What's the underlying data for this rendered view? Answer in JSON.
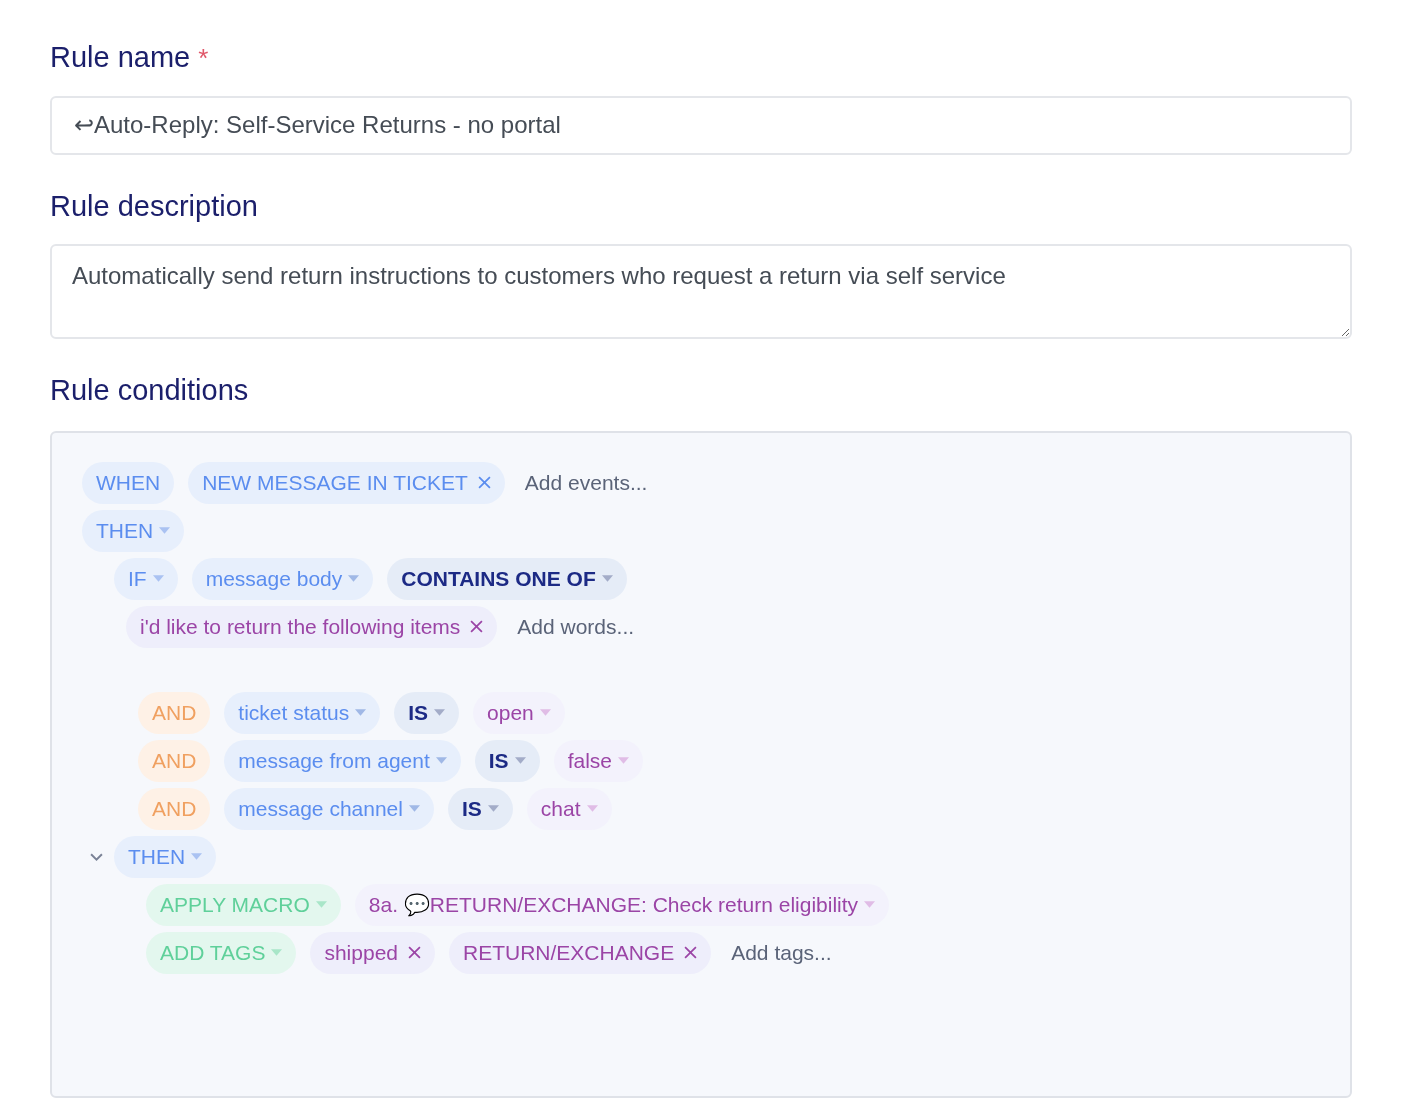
{
  "rule_name": {
    "label": "Rule name",
    "required_mark": "*",
    "value": "↩Auto-Reply: Self-Service Returns - no portal"
  },
  "rule_description": {
    "label": "Rule description",
    "value": "Automatically send return instructions to customers who request a return via self service"
  },
  "rule_conditions": {
    "label": "Rule conditions",
    "rows": [
      {
        "kind": "block",
        "chips": [
          {
            "kind": "keyword",
            "text": "WHEN",
            "caret": false,
            "removable": false
          },
          {
            "kind": "event",
            "text": "NEW MESSAGE IN TICKET",
            "caret": false,
            "removable": true
          }
        ],
        "adder": "Add events..."
      },
      {
        "kind": "block",
        "chips": [
          {
            "kind": "keyword",
            "text": "THEN",
            "caret": true,
            "removable": false
          }
        ],
        "children": [
          {
            "kind": "block",
            "chips": [
              {
                "kind": "keyword",
                "text": "IF",
                "caret": true,
                "removable": false
              },
              {
                "kind": "field",
                "text": "message body",
                "caret": true,
                "removable": false
              },
              {
                "kind": "operator",
                "text": "CONTAINS ONE OF",
                "caret": true,
                "removable": false
              }
            ]
          },
          {
            "kind": "words",
            "chips": [
              {
                "kind": "tag",
                "text": "i'd like to return the following items",
                "caret": false,
                "removable": true
              }
            ],
            "adder": "Add words..."
          },
          {
            "kind": "and",
            "chips": [
              {
                "kind": "and",
                "text": "AND",
                "caret": false,
                "removable": false
              },
              {
                "kind": "field",
                "text": "ticket status",
                "caret": true,
                "removable": false
              },
              {
                "kind": "operator",
                "text": "IS",
                "caret": true,
                "removable": false
              },
              {
                "kind": "value",
                "text": "open",
                "caret": true,
                "removable": false
              }
            ]
          },
          {
            "kind": "and",
            "chips": [
              {
                "kind": "and",
                "text": "AND",
                "caret": false,
                "removable": false
              },
              {
                "kind": "field",
                "text": "message from agent",
                "caret": true,
                "removable": false
              },
              {
                "kind": "operator",
                "text": "IS",
                "caret": true,
                "removable": false
              },
              {
                "kind": "value",
                "text": "false",
                "caret": true,
                "removable": false
              }
            ]
          },
          {
            "kind": "and",
            "chips": [
              {
                "kind": "and",
                "text": "AND",
                "caret": false,
                "removable": false
              },
              {
                "kind": "field",
                "text": "message channel",
                "caret": true,
                "removable": false
              },
              {
                "kind": "operator",
                "text": "IS",
                "caret": true,
                "removable": false
              },
              {
                "kind": "value",
                "text": "chat",
                "caret": true,
                "removable": false
              }
            ]
          },
          {
            "kind": "block",
            "expanded": true,
            "chips": [
              {
                "kind": "keyword",
                "text": "THEN",
                "caret": true,
                "removable": false
              }
            ],
            "children": [
              {
                "kind": "block",
                "chips": [
                  {
                    "kind": "action",
                    "text": "APPLY MACRO",
                    "caret": true,
                    "removable": false
                  },
                  {
                    "kind": "value",
                    "text": "8a. 💬RETURN/EXCHANGE: Check return eligibility",
                    "caret": true,
                    "removable": false
                  }
                ]
              },
              {
                "kind": "block",
                "chips": [
                  {
                    "kind": "action",
                    "text": "ADD TAGS",
                    "caret": true,
                    "removable": false
                  },
                  {
                    "kind": "tag",
                    "text": "shipped",
                    "caret": false,
                    "removable": true
                  },
                  {
                    "kind": "tag",
                    "text": "RETURN/EXCHANGE",
                    "caret": false,
                    "removable": true
                  }
                ],
                "adder": "Add tags..."
              }
            ]
          }
        ]
      }
    ]
  }
}
